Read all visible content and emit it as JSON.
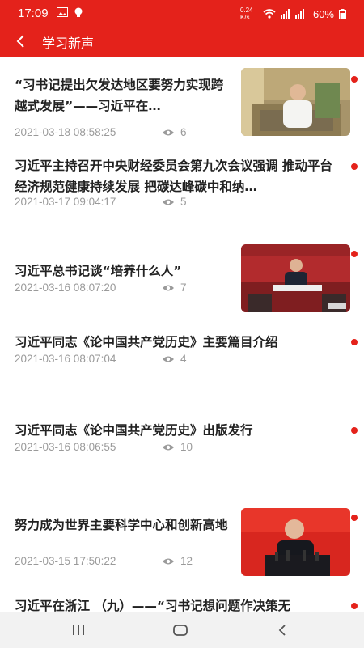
{
  "status_bar": {
    "time": "17:09",
    "network_speed": "0.24 K/s",
    "battery": "60%"
  },
  "header": {
    "title": "学习新声"
  },
  "articles": [
    {
      "title": "“习书记提出欠发达地区要努力实现跨越式发展”——习近平在…",
      "date": "2021-03-18 08:58:25",
      "views": "6"
    },
    {
      "title": "习近平主持召开中央财经委员会第九次会议强调 推动平台经济规范健康持续发展 把碳达峰碳中和纳…",
      "date": "2021-03-17 09:04:17",
      "views": "5"
    },
    {
      "title": "习近平总书记谈“培养什么人”",
      "date": "2021-03-16 08:07:20",
      "views": "7"
    },
    {
      "title": "习近平同志《论中国共产党历史》主要篇目介绍",
      "date": "2021-03-16 08:07:04",
      "views": "4"
    },
    {
      "title": "习近平同志《论中国共产党历史》出版发行",
      "date": "2021-03-16 08:06:55",
      "views": "10"
    },
    {
      "title": "努力成为世界主要科学中心和创新高地",
      "date": "2021-03-15 17:50:22",
      "views": "12"
    },
    {
      "title": "习近平在浙江 （九）——“习书记想问题作决策无",
      "date": "",
      "views": ""
    }
  ],
  "colors": {
    "accent": "#e4221b",
    "muted_text": "#9a9a9a"
  }
}
